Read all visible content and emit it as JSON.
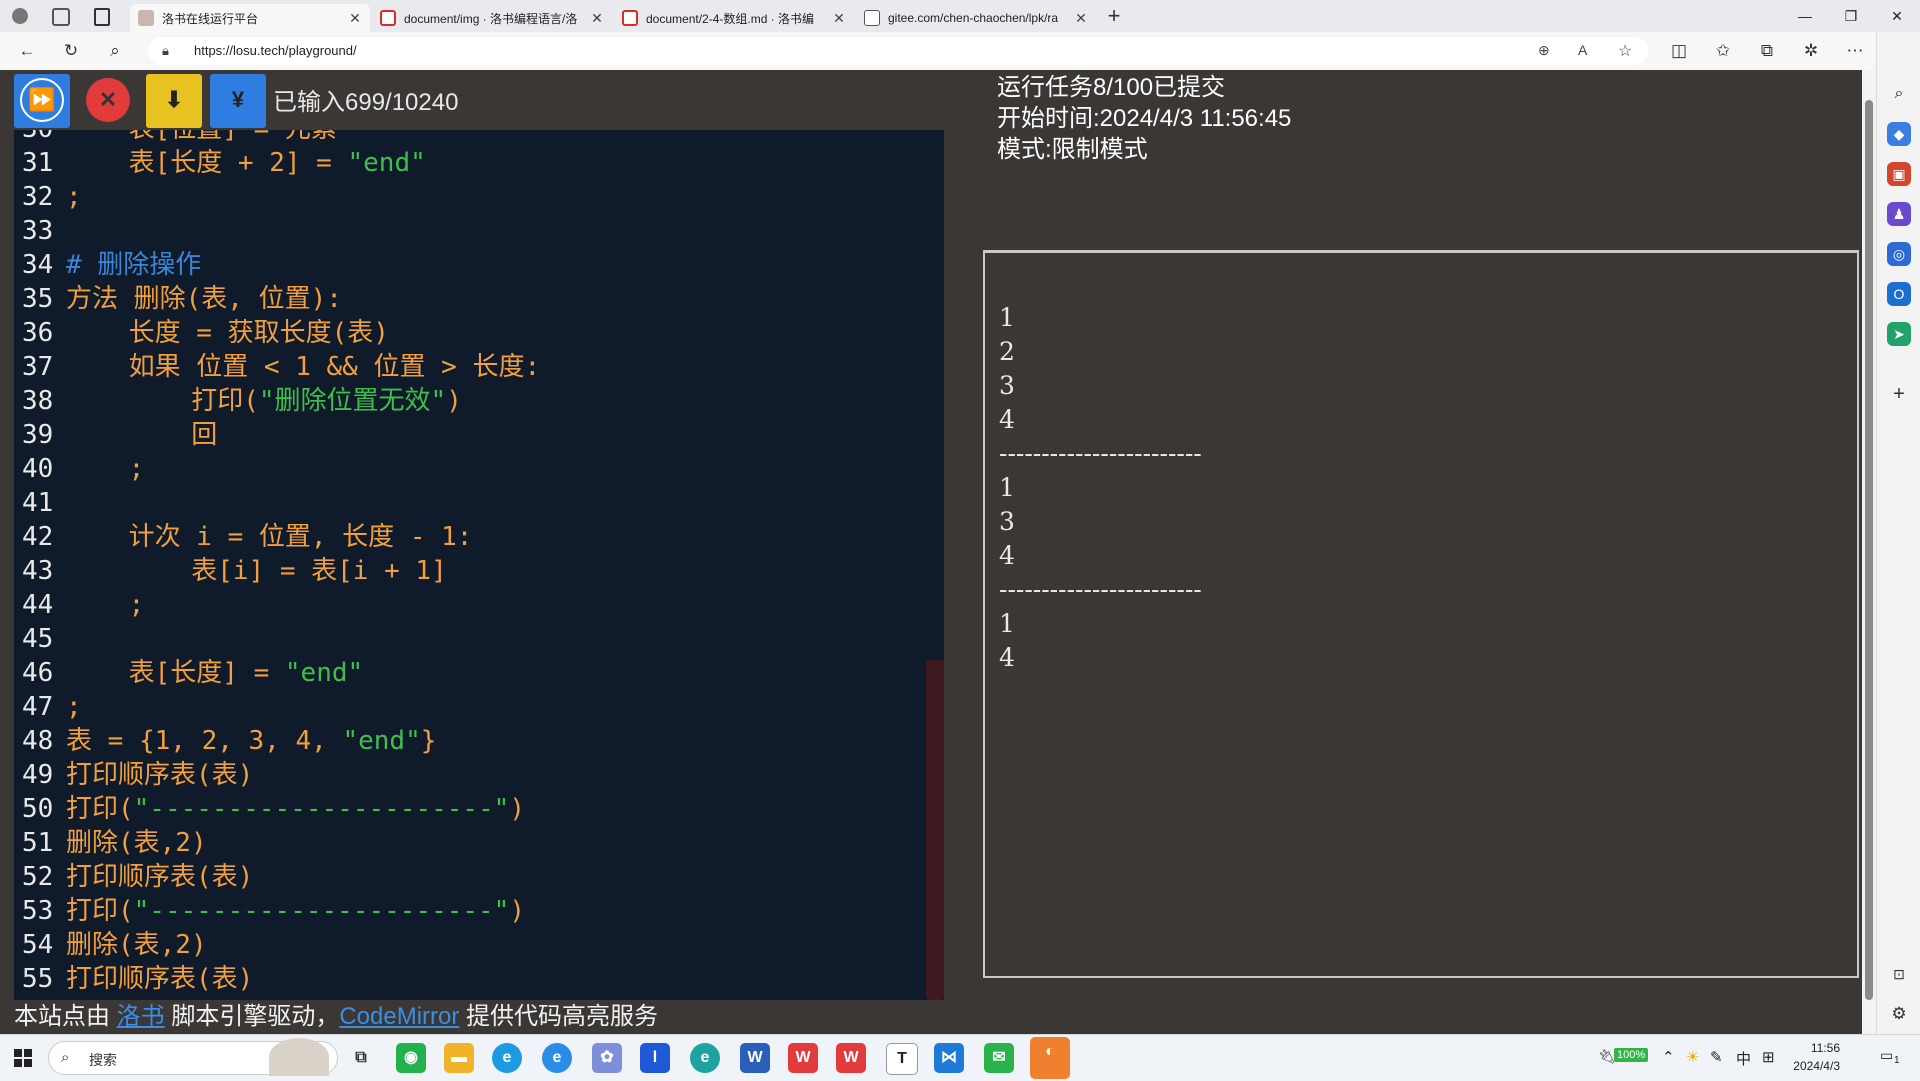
{
  "browser": {
    "tabs": [
      {
        "title": "洛书在线运行平台",
        "favicon": "page-icon",
        "active": true
      },
      {
        "title": "document/img · 洛书编程语言/洛",
        "favicon": "gitee-icon",
        "active": false
      },
      {
        "title": "document/2-4-数组.md · 洛书编",
        "favicon": "gitee-icon",
        "active": false
      },
      {
        "title": "gitee.com/chen-chaochen/lpk/ra",
        "favicon": "document-icon",
        "active": false
      }
    ],
    "url": "https://losu.tech/playground/"
  },
  "toolbar": {
    "buttons": [
      {
        "name": "run",
        "glyph": "⏩",
        "color": "#2f7de1"
      },
      {
        "name": "stop",
        "glyph": "✕",
        "color": "#e23b3b"
      },
      {
        "name": "download",
        "glyph": "⬇",
        "color": "#e8c220"
      },
      {
        "name": "yuan",
        "glyph": "¥",
        "color": "#2f7de1"
      }
    ],
    "counter": "已输入699/10240"
  },
  "editor": {
    "lines": [
      {
        "n": "30",
        "segs": [
          [
            "code",
            "    表[位置] = 元素"
          ]
        ]
      },
      {
        "n": "31",
        "segs": [
          [
            "code",
            "    表[长度 + 2] = "
          ],
          [
            "str",
            "\"end\""
          ]
        ]
      },
      {
        "n": "32",
        "segs": [
          [
            "code",
            ";"
          ]
        ]
      },
      {
        "n": "33",
        "segs": [
          [
            "code",
            ""
          ]
        ]
      },
      {
        "n": "34",
        "segs": [
          [
            "cmt",
            "# 删除操作"
          ]
        ]
      },
      {
        "n": "35",
        "segs": [
          [
            "code",
            "方法 删除(表, 位置):"
          ]
        ]
      },
      {
        "n": "36",
        "segs": [
          [
            "code",
            "    长度 = 获取长度(表)"
          ]
        ]
      },
      {
        "n": "37",
        "segs": [
          [
            "code",
            "    如果 位置 < 1 && 位置 > 长度:"
          ]
        ]
      },
      {
        "n": "38",
        "segs": [
          [
            "code",
            "        打印("
          ],
          [
            "str",
            "\"删除位置无效\""
          ],
          [
            "code",
            ")"
          ]
        ]
      },
      {
        "n": "39",
        "segs": [
          [
            "code",
            "        回"
          ]
        ]
      },
      {
        "n": "40",
        "segs": [
          [
            "code",
            "    ;"
          ]
        ]
      },
      {
        "n": "41",
        "segs": [
          [
            "code",
            ""
          ]
        ]
      },
      {
        "n": "42",
        "segs": [
          [
            "code",
            "    计次 i = 位置, 长度 - 1:"
          ]
        ]
      },
      {
        "n": "43",
        "segs": [
          [
            "code",
            "        表[i] = 表[i + 1]"
          ]
        ]
      },
      {
        "n": "44",
        "segs": [
          [
            "code",
            "    ;"
          ]
        ]
      },
      {
        "n": "45",
        "segs": [
          [
            "code",
            ""
          ]
        ]
      },
      {
        "n": "46",
        "segs": [
          [
            "code",
            "    表[长度] = "
          ],
          [
            "str",
            "\"end\""
          ]
        ]
      },
      {
        "n": "47",
        "segs": [
          [
            "code",
            ";"
          ]
        ]
      },
      {
        "n": "48",
        "segs": [
          [
            "code",
            "表 = {1, 2, 3, 4, "
          ],
          [
            "str",
            "\"end\""
          ],
          [
            "code",
            "}"
          ]
        ]
      },
      {
        "n": "49",
        "segs": [
          [
            "code",
            "打印顺序表(表)"
          ]
        ]
      },
      {
        "n": "50",
        "segs": [
          [
            "code",
            "打印("
          ],
          [
            "str",
            "\"----------------------\""
          ],
          [
            "code",
            ")"
          ]
        ]
      },
      {
        "n": "51",
        "segs": [
          [
            "code",
            "删除(表,2)"
          ]
        ]
      },
      {
        "n": "52",
        "segs": [
          [
            "code",
            "打印顺序表(表)"
          ]
        ]
      },
      {
        "n": "53",
        "segs": [
          [
            "code",
            "打印("
          ],
          [
            "str",
            "\"----------------------\""
          ],
          [
            "code",
            ")"
          ]
        ]
      },
      {
        "n": "54",
        "segs": [
          [
            "code",
            "删除(表,2)"
          ]
        ]
      },
      {
        "n": "55",
        "segs": [
          [
            "code",
            "打印顺序表(表)"
          ]
        ]
      }
    ]
  },
  "footer": {
    "prefix": "本站点由 ",
    "link1": "洛书",
    "middle": " 脚本引擎驱动，",
    "link2": "CodeMirror",
    "suffix": " 提供代码高亮服务"
  },
  "output": {
    "status": "运行任务8/100已提交",
    "start_time": "开始时间:2024/4/3 11:56:45",
    "mode": "模式:限制模式",
    "lines": [
      "1",
      "2",
      "3",
      "4",
      "------------------------",
      "1",
      "3",
      "4",
      "------------------------",
      "1",
      "4"
    ]
  },
  "taskbar": {
    "search_placeholder": "搜索",
    "battery": "100%",
    "ime": "中",
    "time": "11:56",
    "date": "2024/4/3",
    "notification_count": "1"
  }
}
